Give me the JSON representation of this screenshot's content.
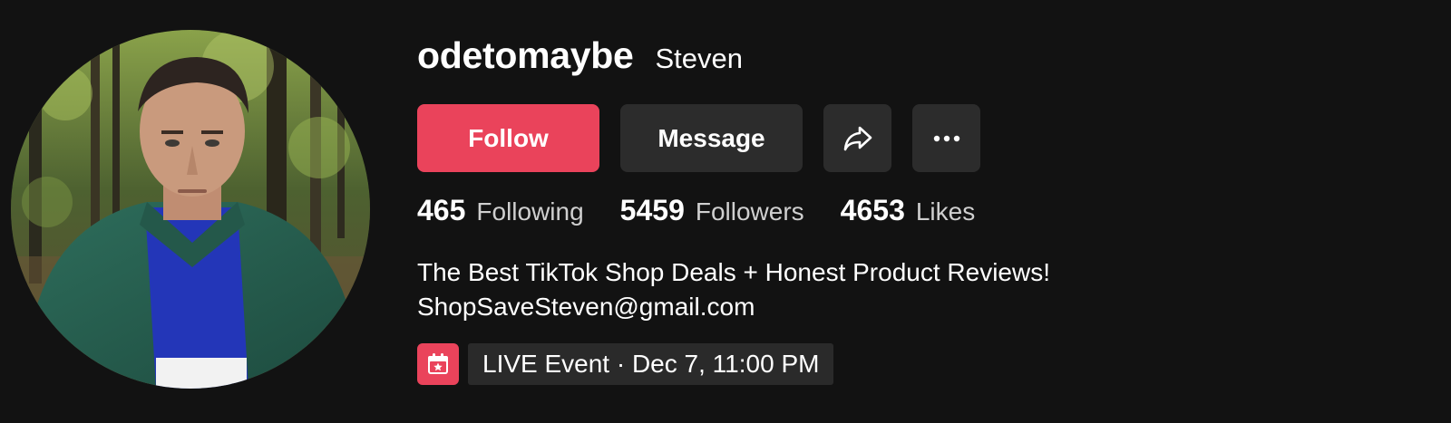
{
  "profile": {
    "username": "odetomaybe",
    "nickname": "Steven",
    "avatar_icon": "profile-photo"
  },
  "actions": {
    "follow_label": "Follow",
    "message_label": "Message",
    "share_icon": "share-arrow-icon",
    "more_icon": "more-ellipsis-icon"
  },
  "stats": [
    {
      "value": "465",
      "label": "Following"
    },
    {
      "value": "5459",
      "label": "Followers"
    },
    {
      "value": "4653",
      "label": "Likes"
    }
  ],
  "bio": {
    "line1": "The Best TikTok Shop Deals + Honest Product Reviews!",
    "line2": "ShopSaveSteven@gmail.com"
  },
  "event": {
    "icon": "calendar-star-icon",
    "label": "LIVE Event · Dec 7, 11:00 PM"
  },
  "colors": {
    "background": "#121212",
    "accent": "#ea435b",
    "button_secondary": "#2c2c2c"
  }
}
